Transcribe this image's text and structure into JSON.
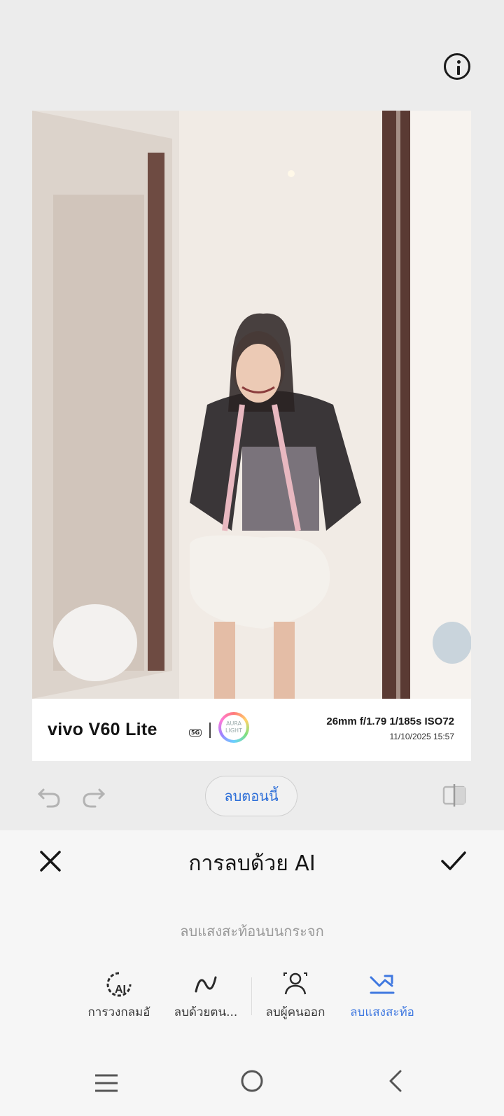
{
  "header": {
    "info_icon": "info-circle-icon"
  },
  "photo": {
    "watermark": {
      "brand": "vivo V60 Lite",
      "network_badge": "5G",
      "aura_text": "AURA LIGHT",
      "specs": "26mm  f/1.79  1/185s  ISO72",
      "datetime": "11/10/2025 15:57"
    }
  },
  "toolbar": {
    "undo_icon": "undo-icon",
    "redo_icon": "redo-icon",
    "remove_now_label": "ลบตอนนี้",
    "compare_icon": "compare-icon"
  },
  "panel": {
    "title": "การลบด้วย AI",
    "hint": "ลบแสงสะท้อนบนกระจก",
    "tools": [
      {
        "label": "การวงกลมอั",
        "icon": "ai-circle-icon",
        "active": false
      },
      {
        "label": "ลบด้วยตน...",
        "icon": "brush-stroke-icon",
        "active": false
      },
      {
        "label": "ลบผู้คนออก",
        "icon": "remove-people-icon",
        "active": false
      },
      {
        "label": "ลบแสงสะท้อ",
        "icon": "remove-reflection-icon",
        "active": true
      }
    ],
    "active_color": "#3f78e0"
  },
  "navbar": {
    "menu_icon": "menu-icon",
    "home_icon": "home-circle-icon",
    "back_icon": "back-chevron-icon"
  }
}
